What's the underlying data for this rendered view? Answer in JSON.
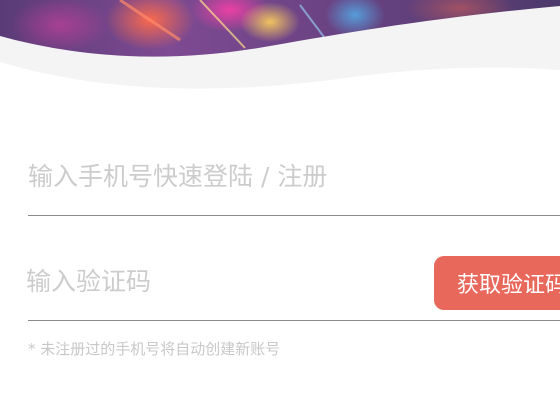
{
  "colors": {
    "accent": "#e8685b",
    "divider": "#8a8a8a",
    "placeholder": "#cccccc",
    "hint": "#c8c8c8",
    "wave": "#f4f4f4"
  },
  "phone": {
    "placeholder": "输入手机号快速登陆 / 注册",
    "value": ""
  },
  "code": {
    "placeholder": "输入验证码",
    "value": "",
    "button_label": "获取验证码"
  },
  "hint_text": "* 未注册过的手机号将自动创建新账号"
}
